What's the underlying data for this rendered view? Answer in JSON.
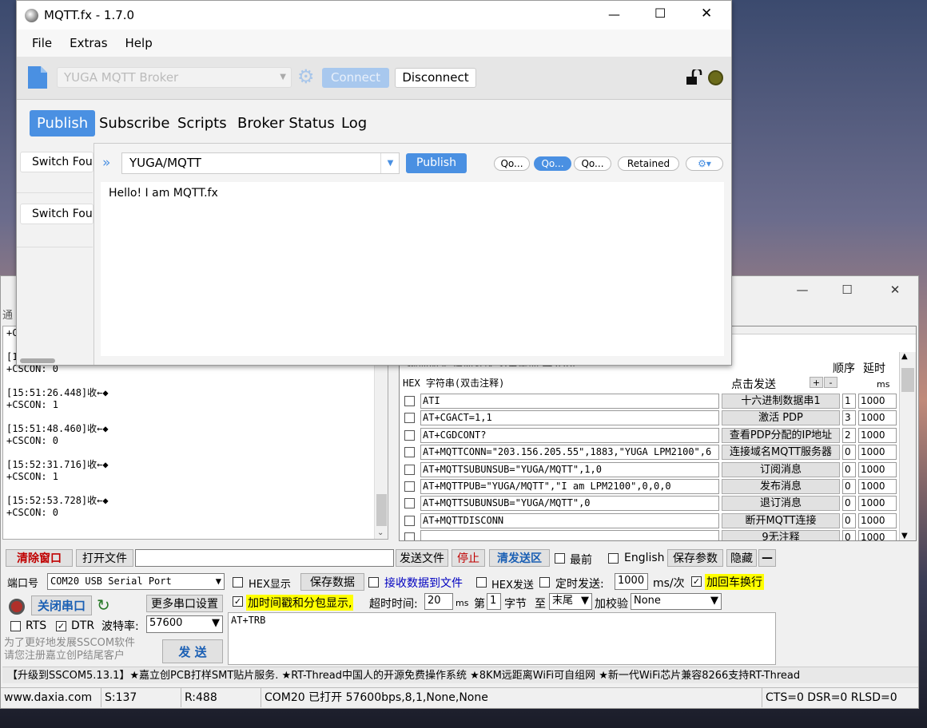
{
  "mqtt": {
    "title": "MQTT.fx - 1.7.0",
    "menu": [
      "File",
      "Extras",
      "Help"
    ],
    "broker": "YUGA MQTT Broker",
    "connect": "Connect",
    "disconnect": "Disconnect",
    "tabs": [
      "Publish",
      "Subscribe",
      "Scripts",
      "Broker Status",
      "Log"
    ],
    "switch_focus": "Switch Fou",
    "topic": "YUGA/MQTT",
    "publish_button": "Publish",
    "qos": [
      "Qo...",
      "Qo...",
      "Qo..."
    ],
    "retained": "Retained",
    "message": "Hello! I am MQTT.fx",
    "expand_glyph": "»"
  },
  "sscom": {
    "log": [
      "+C",
      "",
      "[1",
      "+CSCON: 0",
      "",
      "[15:51:26.448]收←◆",
      "+CSCON: 1",
      "",
      "[15:51:48.460]收←◆",
      "+CSCON: 0",
      "",
      "[15:52:31.716]收←◆",
      "+CSCON: 1",
      "",
      "[15:52:53.728]收←◆",
      "+CSCON: 0"
    ],
    "left_partial": "通",
    "multi_header": {
      "top_partial": "拖动加交    循环发送   多条帮助  导入ini",
      "hex_col": "HEX 字符串(双击注释)",
      "click_send": "点击发送",
      "order": "顺序",
      "delay": "延时",
      "ms": "ms",
      "plus": "+",
      "minus": "-"
    },
    "rows": [
      {
        "cmd": "ATI",
        "btn": "十六进制数据串1",
        "order": "1",
        "delay": "1000"
      },
      {
        "cmd": "AT+CGACT=1,1",
        "btn": "激活 PDP",
        "order": "3",
        "delay": "1000"
      },
      {
        "cmd": "AT+CGDCONT?",
        "btn": "查看PDP分配的IP地址",
        "order": "2",
        "delay": "1000"
      },
      {
        "cmd": "AT+MQTTCONN=\"203.156.205.55\",1883,\"YUGA LPM2100\",6",
        "btn": "连接域名MQTT服务器",
        "order": "0",
        "delay": "1000"
      },
      {
        "cmd": "AT+MQTTSUBUNSUB=\"YUGA/MQTT\",1,0",
        "btn": "订阅消息",
        "order": "0",
        "delay": "1000"
      },
      {
        "cmd": "AT+MQTTPUB=\"YUGA/MQTT\",\"I am LPM2100\",0,0,0",
        "btn": "发布消息",
        "order": "0",
        "delay": "1000"
      },
      {
        "cmd": "AT+MQTTSUBUNSUB=\"YUGA/MQTT\",0",
        "btn": "退订消息",
        "order": "0",
        "delay": "1000"
      },
      {
        "cmd": "AT+MQTTDISCONN",
        "btn": "断开MQTT连接",
        "order": "0",
        "delay": "1000"
      },
      {
        "cmd": "",
        "btn": "9无注释",
        "order": "0",
        "delay": "1000"
      }
    ],
    "toolbar": {
      "clear": "清除窗口",
      "open_file": "打开文件",
      "send_file": "发送文件",
      "stop": "停止",
      "clear_send": "清发送区",
      "topmost": "最前",
      "english": "English",
      "save_params": "保存参数",
      "hide": "隐藏",
      "dash": "—"
    },
    "port_label": "端口号",
    "port_value": "COM20 USB Serial Port",
    "hex_show": "HEX显示",
    "save_data": "保存数据",
    "recv_to_file": "接收数据到文件",
    "hex_send": "HEX发送",
    "timed_send": "定时发送:",
    "interval": "1000",
    "interval_unit": "ms/次",
    "add_crlf": "加回车换行",
    "close_port": "关闭串口",
    "more_settings": "更多串口设置",
    "timestamp": "加时间戳和分包显示,",
    "timeout_label": "超时时间:",
    "timeout": "20",
    "timeout_unit": "ms",
    "byte_no_label": "第",
    "byte_no": "1",
    "byte_unit": "字节",
    "to_label": "至",
    "end_value": "末尾",
    "checksum_label": "加校验",
    "checksum_value": "None",
    "rts": "RTS",
    "dtr": "DTR",
    "baud_label": "波特率:",
    "baud": "57600",
    "send_text": "AT+TRB",
    "promo": "为了更好地发展SSCOM软件\n请您注册嘉立创P结尾客户",
    "send_button": "发 送",
    "ticker": "【升级到SSCOM5.13.1】★嘉立创PCB打样SMT贴片服务. ★RT-Thread中国人的开源免费操作系统 ★8KM远距离WiFi可自组网 ★新一代WiFi芯片兼容8266支持RT-Thread",
    "status": {
      "site": "www.daxia.com",
      "s": "S:137",
      "r": "R:488",
      "port": "COM20 已打开  57600bps,8,1,None,None",
      "lines": "CTS=0 DSR=0 RLSD=0"
    },
    "win_controls": [
      "—",
      "☐",
      "✕"
    ]
  },
  "colors": {
    "accent": "#4a90e2",
    "highlight": "#ffff00",
    "red_label": "#c00000",
    "blue_label": "#0000c0"
  }
}
